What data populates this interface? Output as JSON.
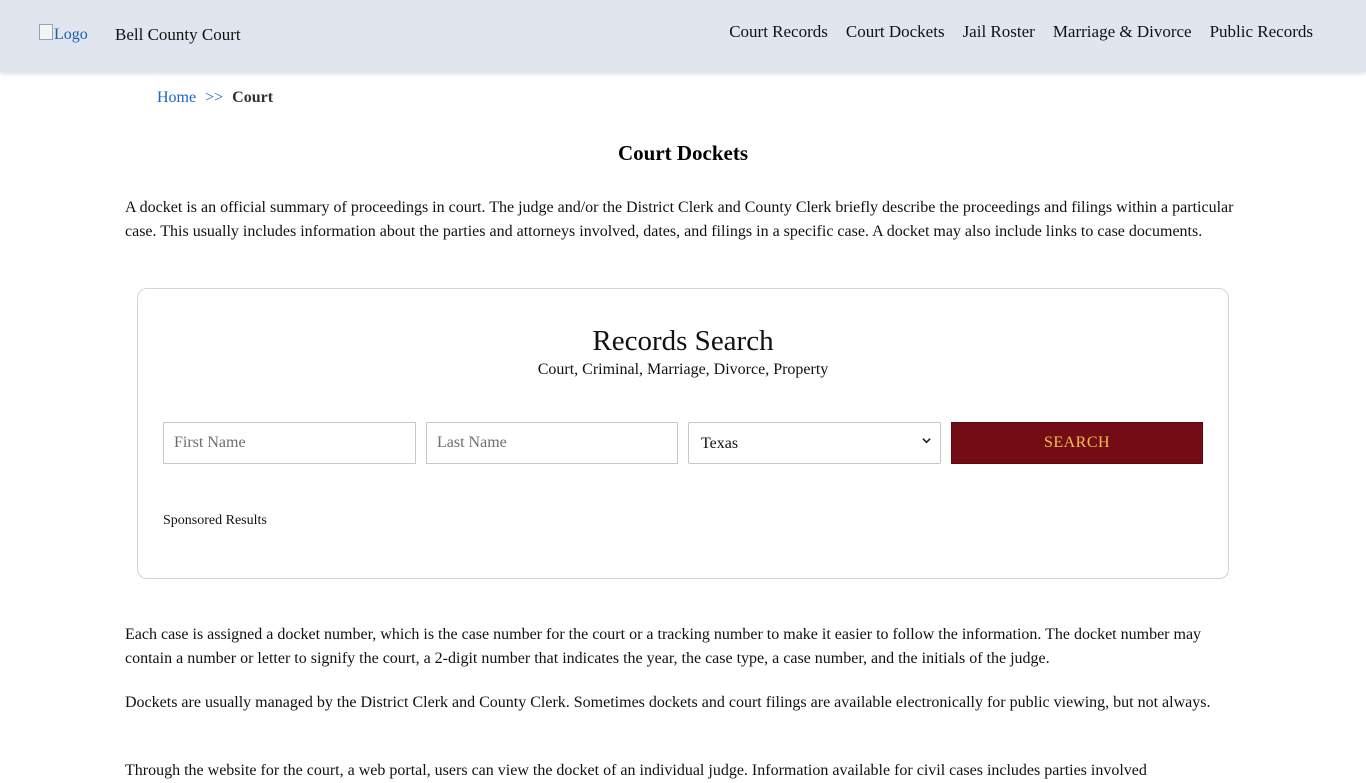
{
  "header": {
    "logo_alt": "Logo",
    "site_title": "Bell County Court",
    "nav": [
      {
        "label": "Court Records"
      },
      {
        "label": "Court Dockets"
      },
      {
        "label": "Jail Roster"
      },
      {
        "label": "Marriage & Divorce"
      },
      {
        "label": "Public Records"
      }
    ]
  },
  "breadcrumb": {
    "home": "Home",
    "separator": ">>",
    "current": "Court"
  },
  "page": {
    "title": "Court Dockets",
    "paragraphs": [
      "A docket is an official summary of proceedings in court. The judge and/or the District Clerk and County Clerk briefly describe the proceedings and filings within a particular case. This usually includes information about the parties and attorneys involved, dates, and filings in a specific case. A docket may also include links to case documents.",
      "Each case is assigned a docket number, which is the case number for the court or a tracking number to make it easier to follow the information. The docket number may contain a number or letter to signify the court, a 2-digit number that indicates the year, the case type, a case number, and the initials of the judge.",
      "Dockets are usually managed by the District Clerk and County Clerk. Sometimes dockets and court filings are available electronically for public viewing, but not always.",
      "Through the website for the court, a web portal, users can view the docket of an individual judge. Information available for civil cases includes parties involved"
    ]
  },
  "search": {
    "title": "Records Search",
    "subtitle": "Court, Criminal, Marriage, Divorce, Property",
    "first_name_placeholder": "First Name",
    "last_name_placeholder": "Last Name",
    "state_selected": "Texas",
    "button_label": "SEARCH",
    "sponsored_label": "Sponsored Results"
  },
  "colors": {
    "header_bg": "#e1e6ee",
    "link_blue": "#1a63c7",
    "button_bg": "#730c15",
    "button_text": "#f0c24c"
  },
  "icons": {
    "logo": "broken-image-icon",
    "select": "chevron-down-icon"
  }
}
